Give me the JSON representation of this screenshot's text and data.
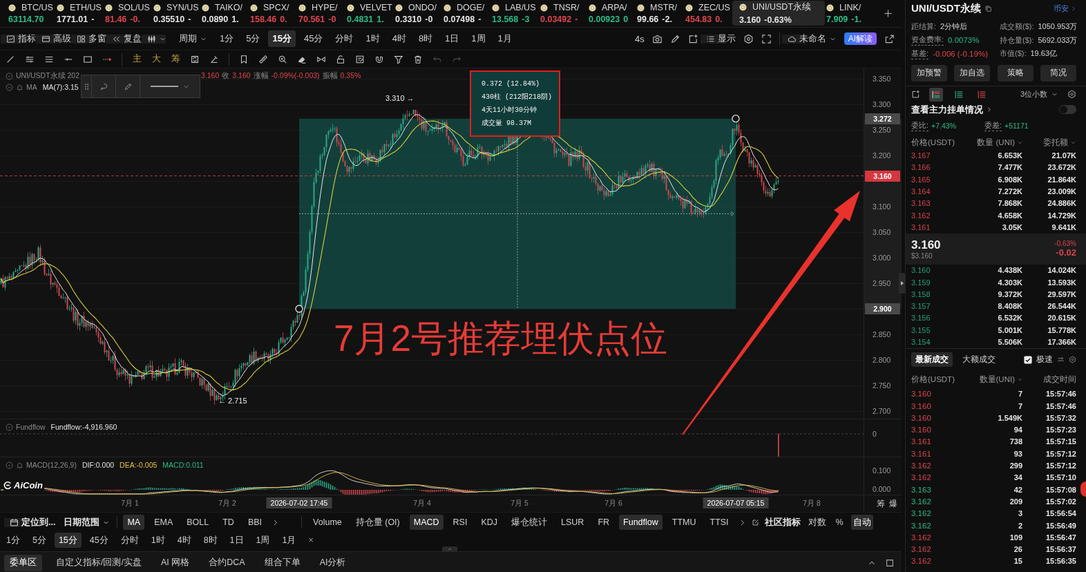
{
  "tickers": [
    {
      "symbol": "BTC/US",
      "price": "63114.70",
      "color": "#2ebd85",
      "selected": false
    },
    {
      "symbol": "ETH/US",
      "price": "1771.01",
      "change": "-",
      "color": "#e6e6e6",
      "selected": false
    },
    {
      "symbol": "SOL/US",
      "price": "81.46",
      "change": "-0.",
      "color": "#e0464f",
      "selected": false
    },
    {
      "symbol": "SYN/US",
      "price": "0.35510",
      "change": "-",
      "color": "#e6e6e6",
      "selected": false
    },
    {
      "symbol": "TAIKO/",
      "price": "0.0890",
      "change": "1.",
      "color": "#e6e6e6",
      "selected": false
    },
    {
      "symbol": "SPCX/",
      "price": "158.46",
      "change": "0.",
      "color": "#e0464f",
      "selected": false
    },
    {
      "symbol": "HYPE/",
      "price": "70.561",
      "change": "-0",
      "color": "#e0464f",
      "selected": false
    },
    {
      "symbol": "VELVET",
      "price": "0.4831",
      "change": "1.",
      "color": "#2ebd85",
      "selected": false
    },
    {
      "symbol": "ONDO/",
      "price": "0.3310",
      "change": "-0",
      "color": "#e6e6e6",
      "selected": false
    },
    {
      "symbol": "DOGE/",
      "price": "0.07498",
      "change": "-",
      "color": "#e6e6e6",
      "selected": false
    },
    {
      "symbol": "LAB/US",
      "price": "13.568",
      "change": "-3",
      "color": "#2ebd85",
      "selected": false
    },
    {
      "symbol": "TNSR/",
      "price": "0.03492",
      "change": "-",
      "color": "#e0464f",
      "selected": false
    },
    {
      "symbol": "ARPA/",
      "price": "0.00923",
      "change": "0",
      "color": "#2ebd85",
      "selected": false
    },
    {
      "symbol": "MSTR/",
      "price": "99.66",
      "change": "-2.",
      "color": "#e6e6e6",
      "selected": false
    },
    {
      "symbol": "ZEC/US",
      "price": "454.83",
      "change": "0.",
      "color": "#e0464f",
      "selected": false
    },
    {
      "symbol": "UNI/USDT永续",
      "price": "3.160",
      "change": "-0.63%",
      "color": "#e6e6e6",
      "selected": true
    },
    {
      "symbol": "LINK/",
      "price": "7.909",
      "change": "-1.",
      "color": "#2ebd85",
      "selected": false
    }
  ],
  "toolbar": {
    "tools": [
      "指标",
      "高级",
      "多窗",
      "复盘"
    ],
    "period": "周期",
    "intervals": [
      {
        "label": "1分",
        "selected": false
      },
      {
        "label": "5分",
        "selected": false
      },
      {
        "label": "15分",
        "selected": true
      },
      {
        "label": "45分",
        "selected": false
      },
      {
        "label": "分时",
        "selected": false
      },
      {
        "label": "1时",
        "selected": false
      },
      {
        "label": "4时",
        "selected": false
      },
      {
        "label": "8时",
        "selected": false
      },
      {
        "label": "1日",
        "selected": false
      },
      {
        "label": "1周",
        "selected": false
      },
      {
        "label": "1月",
        "selected": false
      }
    ],
    "refresh": "4s",
    "display": "显示",
    "layout": "未命名",
    "ai": "AI解读"
  },
  "draw_toolbar": {
    "layers": [
      "主",
      "大",
      "筹"
    ]
  },
  "chart": {
    "legend": {
      "symbol": "UNI/USDT永续 202",
      "values": [
        {
          "kind": "value",
          "text": "3.160"
        },
        {
          "kind": "label",
          "text": "收"
        },
        {
          "kind": "value",
          "text": "3.160"
        },
        {
          "kind": "label",
          "text": "涨幅"
        },
        {
          "kind": "value",
          "text": "-0.09%(-0.003)"
        },
        {
          "kind": "label",
          "text": "振幅"
        },
        {
          "kind": "value",
          "text": "0.35%"
        }
      ]
    },
    "ma": {
      "label": "MA",
      "value": "MA(7):3.15"
    },
    "high_label": "3.310 →",
    "low_label": "← 2.715",
    "measure": [
      "0.372 (12.84%)",
      "430柱 (212阳218阴)",
      "4天11小时30分钟",
      "成交量 98.37M"
    ],
    "annotation": "7月2号推荐埋伏点位",
    "price_axis": [
      "3.350",
      "3.300",
      "3.250",
      "3.200",
      "3.100",
      "3.050",
      "3.000",
      "2.950",
      "2.850",
      "2.800",
      "2.750",
      "2.700"
    ],
    "price_markers": [
      {
        "kind": "range",
        "text": "3.272"
      },
      {
        "kind": "last",
        "text": "3.160"
      },
      {
        "kind": "range",
        "text": "2.900"
      }
    ]
  },
  "fundflow": {
    "label": "Fundflow",
    "value": "Fundflow:-4,916.960",
    "axis": [
      "0"
    ]
  },
  "macd": {
    "label": "MACD(12,26,9)",
    "values": [
      {
        "text": "DIF:0.000",
        "color": "#e6e6e6"
      },
      {
        "text": "DEA:-0.005",
        "color": "#e8c547"
      },
      {
        "text": "MACD:0.011",
        "color": "#2ebd85"
      }
    ],
    "axis": [
      "0.100",
      "0.000"
    ]
  },
  "logo": "AiCoin",
  "time_axis": {
    "labels": [
      "7月 1",
      "7月 2",
      "7月 4",
      "7月 5",
      "7月 6",
      "7月 8"
    ],
    "markers": [
      "2026-07-02 17:45",
      "2026-07-07 05:15"
    ],
    "extras": [
      "筹",
      "爆"
    ]
  },
  "indicator_bar": {
    "locate": "定位到...",
    "date_range": "日期范围",
    "main": [
      {
        "label": "MA",
        "selected": true
      },
      {
        "label": "EMA",
        "selected": false
      },
      {
        "label": "BOLL",
        "selected": false
      },
      {
        "label": "TD",
        "selected": false
      },
      {
        "label": "BBI",
        "selected": false
      }
    ],
    "sub": [
      {
        "label": "Volume",
        "selected": false
      },
      {
        "label": "持仓量 (OI)",
        "selected": false
      },
      {
        "label": "MACD",
        "selected": true
      },
      {
        "label": "RSI",
        "selected": false
      },
      {
        "label": "KDJ",
        "selected": false
      },
      {
        "label": "爆仓统计",
        "selected": false
      },
      {
        "label": "LSUR",
        "selected": false
      },
      {
        "label": "FR",
        "selected": false
      },
      {
        "label": "Fundflow",
        "selected": true
      },
      {
        "label": "TTMU",
        "selected": false
      },
      {
        "label": "TTSI",
        "selected": false
      }
    ],
    "community": "社区指标",
    "options": [
      {
        "label": "对数",
        "selected": false
      },
      {
        "label": "%",
        "selected": false
      },
      {
        "label": "自动",
        "selected": true
      }
    ]
  },
  "interval_bar": {
    "intervals": [
      {
        "label": "1分",
        "selected": false
      },
      {
        "label": "5分",
        "selected": false
      },
      {
        "label": "15分",
        "selected": true
      },
      {
        "label": "45分",
        "selected": false
      },
      {
        "label": "分时",
        "selected": false
      },
      {
        "label": "1时",
        "selected": false
      },
      {
        "label": "4时",
        "selected": false
      },
      {
        "label": "8时",
        "selected": false
      },
      {
        "label": "1日",
        "selected": false
      },
      {
        "label": "1周",
        "selected": false
      },
      {
        "label": "1月",
        "selected": false
      }
    ],
    "close": "×"
  },
  "bottom_tabs": [
    {
      "label": "委单区",
      "selected": true
    },
    {
      "label": "自定义指标/回测/实盘",
      "selected": false
    },
    {
      "label": "AI 网格",
      "selected": false
    },
    {
      "label": "合约DCA",
      "selected": false
    },
    {
      "label": "组合下单",
      "selected": false
    },
    {
      "label": "AI分析",
      "selected": false
    }
  ],
  "market": {
    "title": "UNI/USDT永续",
    "exchange": "币安",
    "stats": [
      {
        "label": "距结算:",
        "value": "2分钟后",
        "dotted": false
      },
      {
        "label": "成交额($):",
        "value": "1050.953万",
        "dotted": false
      },
      {
        "label": "资金费率:",
        "value": "0.0073%",
        "color": "#2ebd85",
        "dotted": true
      },
      {
        "label": "持仓量($):",
        "value": "5692.033万",
        "dotted": false
      },
      {
        "label": "基差:",
        "value": "-0.006 (-0.19%)",
        "color": "#e0464f",
        "dotted": true
      },
      {
        "label": "市值($):",
        "value": "19.63亿",
        "dotted": false
      }
    ],
    "actions": [
      "加预警",
      "加自选",
      "策略",
      "简况"
    ]
  },
  "order_book": {
    "views": [
      {
        "kind": "both",
        "selected": true
      },
      {
        "kind": "bids",
        "selected": false
      },
      {
        "kind": "asks",
        "selected": false
      }
    ],
    "precision": "3位小数",
    "main_orders": {
      "label": "查看主力挂单情况",
      "on": false
    },
    "ratio": [
      {
        "label": "委比:",
        "value": "+7.43%"
      },
      {
        "label": "委差:",
        "value": "+51171"
      }
    ],
    "columns": [
      {
        "label": "价格(USDT)",
        "dropdown": false
      },
      {
        "label": "数量 (UNI)",
        "dropdown": true
      },
      {
        "label": "委托额",
        "dropdown": true
      }
    ],
    "asks": [
      {
        "price": "3.167",
        "amount": "6.653K",
        "total": "21.07K"
      },
      {
        "price": "3.166",
        "amount": "7.477K",
        "total": "23.672K"
      },
      {
        "price": "3.165",
        "amount": "6.908K",
        "total": "21.864K"
      },
      {
        "price": "3.164",
        "amount": "7.272K",
        "total": "23.009K"
      },
      {
        "price": "3.163",
        "amount": "7.868K",
        "total": "24.886K"
      },
      {
        "price": "3.162",
        "amount": "4.658K",
        "total": "14.729K"
      },
      {
        "price": "3.161",
        "amount": "3.05K",
        "total": "9.641K"
      }
    ],
    "last": {
      "price": "3.160",
      "usd": "$3.160",
      "change_pct": "-0.63%",
      "change": "-0.02"
    },
    "bids": [
      {
        "price": "3.160",
        "amount": "4.438K",
        "total": "14.024K"
      },
      {
        "price": "3.159",
        "amount": "4.303K",
        "total": "13.593K"
      },
      {
        "price": "3.158",
        "amount": "9.372K",
        "total": "29.597K"
      },
      {
        "price": "3.157",
        "amount": "8.408K",
        "total": "26.544K"
      },
      {
        "price": "3.156",
        "amount": "6.532K",
        "total": "20.615K"
      },
      {
        "price": "3.155",
        "amount": "5.001K",
        "total": "15.778K"
      },
      {
        "price": "3.154",
        "amount": "5.506K",
        "total": "17.366K"
      }
    ]
  },
  "trades": {
    "tabs": [
      {
        "label": "最新成交",
        "selected": true
      },
      {
        "label": "大额成交",
        "selected": false
      }
    ],
    "fast": {
      "label": "极速",
      "checked": true
    },
    "columns": [
      {
        "label": "价格(USDT)",
        "dropdown": false
      },
      {
        "label": "数量(UNI)",
        "dropdown": true
      },
      {
        "label": "成交时间",
        "dropdown": false
      }
    ],
    "rows": [
      {
        "price": "3.160",
        "amount": "7",
        "time": "15:57:46",
        "color": "#e0464f"
      },
      {
        "price": "3.160",
        "amount": "7",
        "time": "15:57:46",
        "color": "#e0464f"
      },
      {
        "price": "3.160",
        "amount": "1.549K",
        "time": "15:57:32",
        "color": "#e0464f"
      },
      {
        "price": "3.160",
        "amount": "94",
        "time": "15:57:23",
        "color": "#e0464f"
      },
      {
        "price": "3.161",
        "amount": "738",
        "time": "15:57:15",
        "color": "#e0464f"
      },
      {
        "price": "3.161",
        "amount": "93",
        "time": "15:57:12",
        "color": "#e0464f"
      },
      {
        "price": "3.162",
        "amount": "299",
        "time": "15:57:12",
        "color": "#e0464f"
      },
      {
        "price": "3.162",
        "amount": "34",
        "time": "15:57:10",
        "color": "#e0464f"
      },
      {
        "price": "3.163",
        "amount": "42",
        "time": "15:57:08",
        "color": "#2ebd85"
      },
      {
        "price": "3.162",
        "amount": "209",
        "time": "15:57:02",
        "color": "#2ebd85"
      },
      {
        "price": "3.162",
        "amount": "3",
        "time": "15:56:54",
        "color": "#2ebd85"
      },
      {
        "price": "3.162",
        "amount": "2",
        "time": "15:56:49",
        "color": "#2ebd85"
      },
      {
        "price": "3.162",
        "amount": "109",
        "time": "15:56:47",
        "color": "#e0464f"
      },
      {
        "price": "3.162",
        "amount": "26",
        "time": "15:56:37",
        "color": "#e0464f"
      },
      {
        "price": "3.162",
        "amount": "15",
        "time": "15:56:35",
        "color": "#e0464f"
      }
    ]
  }
}
